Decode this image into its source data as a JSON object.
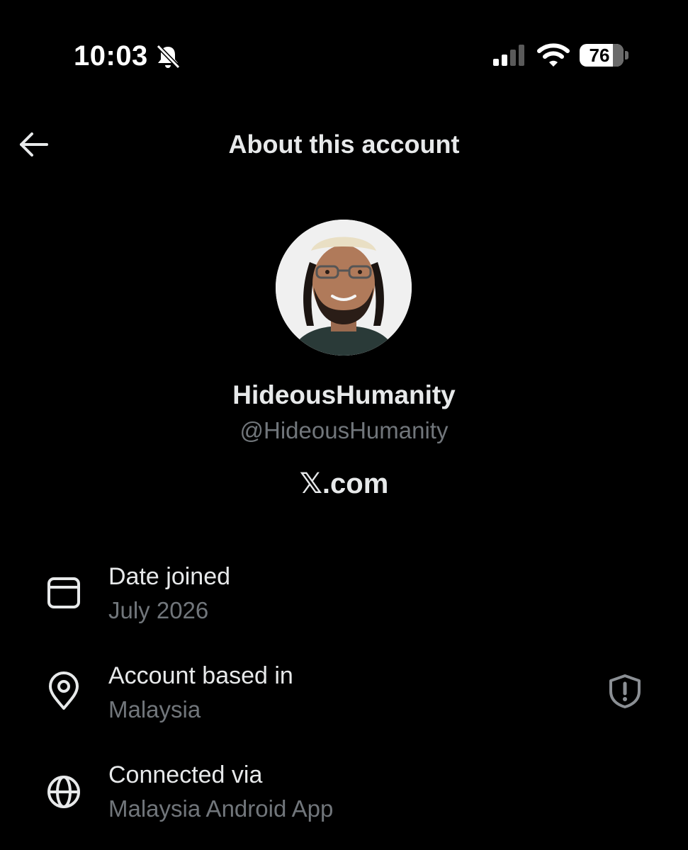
{
  "status_bar": {
    "time": "10:03",
    "battery": "76",
    "battery_level_percent": 76,
    "icons": [
      "bell-slash-icon",
      "cellular-signal-icon",
      "wifi-icon",
      "battery-icon"
    ]
  },
  "header": {
    "title": "About this account",
    "back_icon": "arrow-left-icon"
  },
  "profile": {
    "display_name": "HideousHumanity",
    "handle": "@HideousHumanity",
    "platform": "𝕏.com"
  },
  "details": [
    {
      "icon": "calendar-icon",
      "label": "Date joined",
      "value": "July 2026"
    },
    {
      "icon": "location-pin-icon",
      "label": "Account based in",
      "value": "Malaysia",
      "trailing_icon": "shield-alert-icon"
    },
    {
      "icon": "globe-icon",
      "label": "Connected via",
      "value": "Malaysia Android App"
    }
  ],
  "colors": {
    "background": "#000000",
    "primary_text": "#e7e9ea",
    "secondary_text": "#71767b"
  }
}
